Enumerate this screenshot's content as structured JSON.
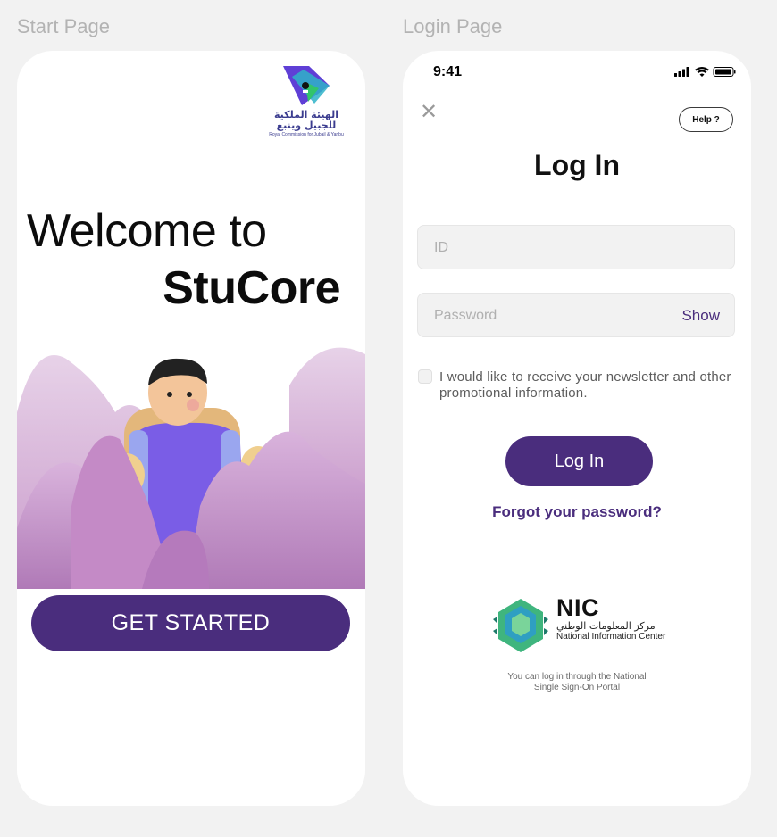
{
  "frames": {
    "start_label": "Start Page",
    "login_label": "Login Page"
  },
  "start": {
    "logo": {
      "arabic_line1": "الهيئة الملكية",
      "arabic_line2": "للجبيل وينبع",
      "english": "Royal Commission for Jubail & Yanbu"
    },
    "welcome_line1": "Welcome to",
    "welcome_line2": "StuCore",
    "illustration": "character-with-backpack",
    "get_started_label": "GET STARTED"
  },
  "login": {
    "status_bar": {
      "time": "9:41",
      "icons": [
        "signal-icon",
        "wifi-icon",
        "battery-icon"
      ]
    },
    "close_icon": "close-icon",
    "help_label": "Help ?",
    "title": "Log In",
    "id_placeholder": "ID",
    "password_placeholder": "Password",
    "show_label": "Show",
    "newsletter_text": "I would like to receive your newsletter and other promotional information.",
    "newsletter_checked": false,
    "login_button_label": "Log In",
    "forgot_password_label": "Forgot your password?",
    "nic": {
      "abbr": "NIC",
      "arabic": "مركز المعلومات الوطني",
      "english": "National Information Center"
    },
    "sso_caption_line1": "You can log in through the National",
    "sso_caption_line2": "Single Sign-On Portal"
  },
  "colors": {
    "brand_purple": "#4a2d7d",
    "background": "#f2f2f2",
    "card": "#ffffff"
  }
}
